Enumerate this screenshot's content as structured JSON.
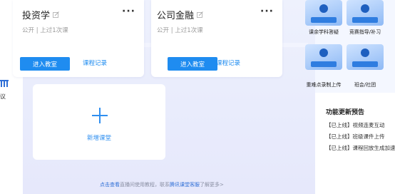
{
  "left_strip": {
    "label": "议"
  },
  "courses": [
    {
      "title": "投资学",
      "meta": "公开 | 上过1次课",
      "more": "···",
      "enter_label": "进入教室",
      "record_label": "课程记录"
    },
    {
      "title": "公司金融",
      "meta": "公开 | 上过1次课",
      "more": "···",
      "enter_label": "进入教室",
      "record_label": "课程记录"
    }
  ],
  "new_course": {
    "label": "新增课堂"
  },
  "footer": {
    "link1": "点击查看",
    "text1": "直播间使用教程，联系",
    "link2": "腾讯课堂客服",
    "text2": "了解更多>"
  },
  "features": [
    {
      "label": "课余学科答疑",
      "icon": "tutoring-illustration"
    },
    {
      "label": "竞赛指导/补习",
      "icon": "coaching-illustration"
    },
    {
      "label": "重难点录制上传",
      "icon": "recording-illustration"
    },
    {
      "label": "班会/社团",
      "icon": "club-meeting-illustration"
    }
  ],
  "updates": {
    "title": "功能更新预告",
    "items": [
      "【已上线】视频连麦互动",
      "【已上线】班级课件上传",
      "【已上线】课程回放生成加速"
    ]
  },
  "colors": {
    "accent": "#1f8cf0",
    "page_bg": "#eef1fd",
    "card_bg": "#ffffff"
  }
}
